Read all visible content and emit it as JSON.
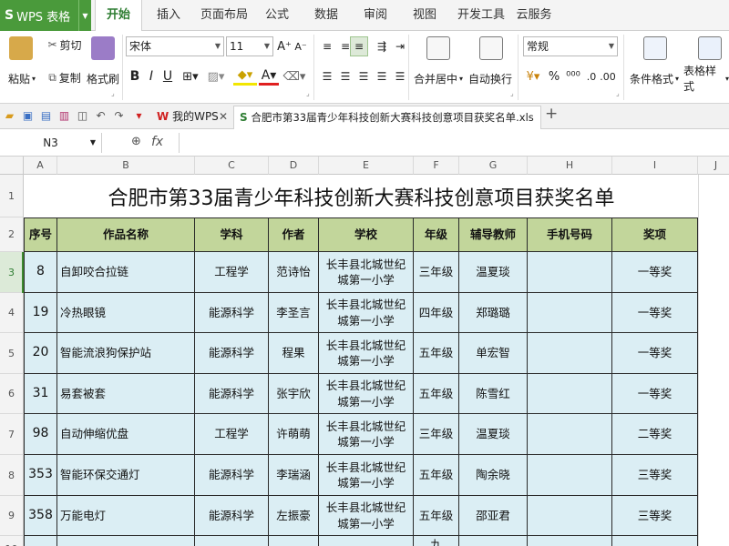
{
  "app": {
    "logo": "S",
    "name": "WPS 表格",
    "menu_tabs": [
      "开始",
      "插入",
      "页面布局",
      "公式",
      "数据",
      "审阅",
      "视图",
      "开发工具",
      "云服务"
    ],
    "active_tab": "开始"
  },
  "ribbon": {
    "cut": "剪切",
    "paste": "粘贴",
    "copy": "复制",
    "format_painter": "格式刷",
    "font_name": "宋体",
    "font_size": "11",
    "bold": "B",
    "italic": "I",
    "underline": "U",
    "merge_center": "合并居中",
    "wrap_text": "自动换行",
    "number_format": "常规",
    "percent": "%",
    "conditional_format": "条件格式",
    "table_style": "表格样式"
  },
  "doc_tabs": {
    "my_wps": "我的WPS",
    "file": "合肥市第33届青少年科技创新大赛科技创意项目获奖名单.xls *"
  },
  "formula_bar": {
    "cell_ref": "N3",
    "fx": "fx",
    "value": ""
  },
  "sheet": {
    "columns": [
      "A",
      "B",
      "C",
      "D",
      "E",
      "F",
      "G",
      "H",
      "I",
      "J"
    ],
    "row_numbers": [
      "1",
      "2",
      "3",
      "4",
      "5",
      "6",
      "7",
      "8",
      "9",
      "10"
    ],
    "title": "合肥市第33届青少年科技创新大赛科技创意项目获奖名单",
    "headers": [
      "序号",
      "作品名称",
      "学科",
      "作者",
      "学校",
      "年级",
      "辅导教师",
      "手机号码",
      "奖项"
    ],
    "rows": [
      {
        "no": "8",
        "name": "自卸咬合拉链",
        "subject": "工程学",
        "author": "范诗怡",
        "school": "长丰县北城世纪城第一小学",
        "grade": "三年级",
        "teacher": "温夏琰",
        "phone": "",
        "award": "一等奖"
      },
      {
        "no": "19",
        "name": "冷热眼镜",
        "subject": "能源科学",
        "author": "李圣言",
        "school": "长丰县北城世纪城第一小学",
        "grade": "四年级",
        "teacher": "郑璐璐",
        "phone": "",
        "award": "一等奖"
      },
      {
        "no": "20",
        "name": "智能流浪狗保护站",
        "subject": "能源科学",
        "author": "程果",
        "school": "长丰县北城世纪城第一小学",
        "grade": "五年级",
        "teacher": "单宏智",
        "phone": "",
        "award": "一等奖"
      },
      {
        "no": "31",
        "name": "易套被套",
        "subject": "能源科学",
        "author": "张宇欣",
        "school": "长丰县北城世纪城第一小学",
        "grade": "五年级",
        "teacher": "陈雪红",
        "phone": "",
        "award": "一等奖"
      },
      {
        "no": "98",
        "name": "自动伸缩优盘",
        "subject": "工程学",
        "author": "许萌萌",
        "school": "长丰县北城世纪城第一小学",
        "grade": "三年级",
        "teacher": "温夏琰",
        "phone": "",
        "award": "二等奖"
      },
      {
        "no": "353",
        "name": "智能环保交通灯",
        "subject": "能源科学",
        "author": "李瑞涵",
        "school": "长丰县北城世纪城第一小学",
        "grade": "五年级",
        "teacher": "陶余晓",
        "phone": "",
        "award": "三等奖"
      },
      {
        "no": "358",
        "name": "万能电灯",
        "subject": "能源科学",
        "author": "左振豪",
        "school": "长丰县北城世纪城第一小学",
        "grade": "五年级",
        "teacher": "邵亚君",
        "phone": "",
        "award": "三等奖"
      }
    ],
    "partial_row_text": "九"
  },
  "colors": {
    "brand_green": "#4a9a3b",
    "header_fill": "#c2d69b",
    "data_fill": "#dbeef4"
  }
}
